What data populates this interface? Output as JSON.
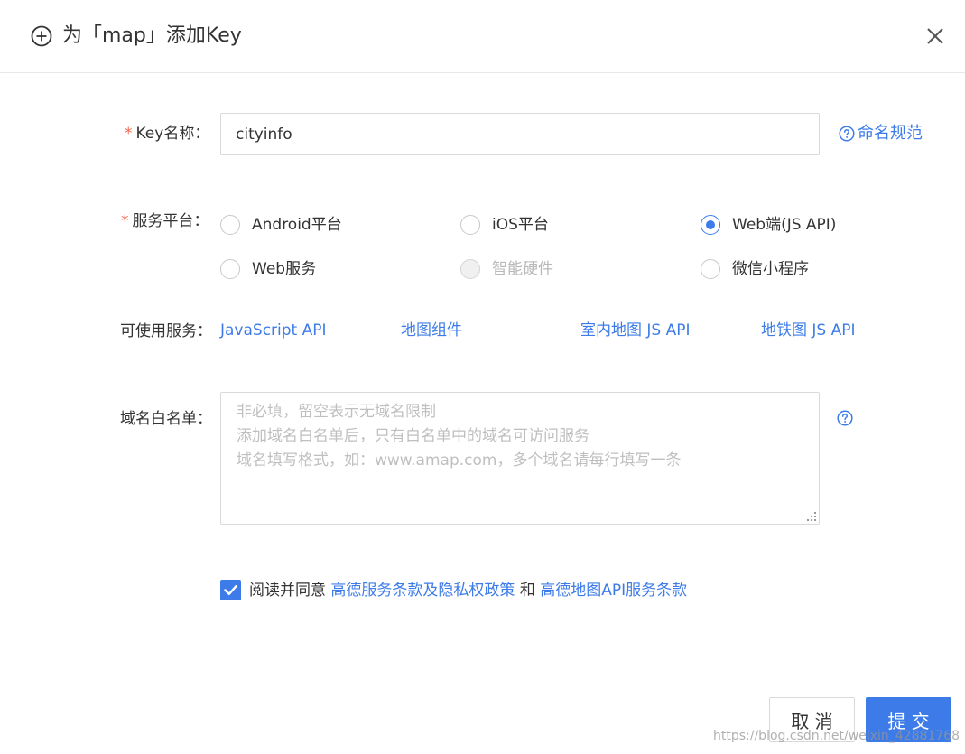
{
  "dialog": {
    "title": "为「map」添加Key",
    "accent_color": "#3d7ce8"
  },
  "form": {
    "key_name": {
      "required_mark": "*",
      "label": "Key名称：",
      "value": "cityinfo",
      "help_link": "命名规范"
    },
    "platform": {
      "required_mark": "*",
      "label": "服务平台：",
      "options": [
        {
          "label": "Android平台",
          "checked": false,
          "disabled": false
        },
        {
          "label": "iOS平台",
          "checked": false,
          "disabled": false
        },
        {
          "label": "Web端(JS API)",
          "checked": true,
          "disabled": false
        },
        {
          "label": "Web服务",
          "checked": false,
          "disabled": false
        },
        {
          "label": "智能硬件",
          "checked": false,
          "disabled": true
        },
        {
          "label": "微信小程序",
          "checked": false,
          "disabled": false
        }
      ]
    },
    "services": {
      "label": "可使用服务：",
      "items": [
        "JavaScript API",
        "地图组件",
        "室内地图 JS API",
        "地铁图 JS API"
      ]
    },
    "whitelist": {
      "label": "域名白名单：",
      "placeholder_lines": [
        "非必填，留空表示无域名限制",
        "添加域名白名单后，只有白名单中的域名可访问服务",
        "域名填写格式，如：www.amap.com，多个域名请每行填写一条"
      ]
    },
    "agreement": {
      "checked": true,
      "prefix": "阅读并同意",
      "link1": "高德服务条款及隐私权政策",
      "middle": "和",
      "link2": "高德地图API服务条款"
    }
  },
  "footer": {
    "cancel_label": "取 消",
    "submit_label": "提 交"
  },
  "watermark": "https://blog.csdn.net/weixin_42881768"
}
